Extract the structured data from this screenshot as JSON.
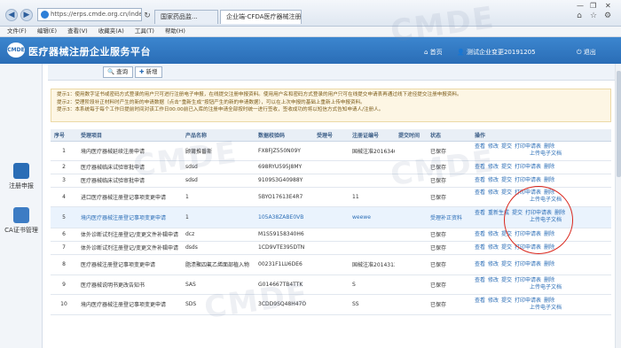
{
  "browser": {
    "address": "https://erps.cmde.org.cn/index/",
    "tabs": [
      "国家药品监...",
      "企业端-CFDA医疗器械注册..."
    ],
    "menus": [
      "文件(F)",
      "编辑(E)",
      "查看(V)",
      "收藏夹(A)",
      "工具(T)",
      "帮助(H)"
    ],
    "controls": {
      "min": "—",
      "max": "❐",
      "close": "✕"
    }
  },
  "header": {
    "logo_text": "CMDE",
    "title": "医疗器械注册企业服务平台",
    "home": "首页",
    "user": "测试企业变更20191205",
    "logout": "退出"
  },
  "sidebar": {
    "items": [
      {
        "label": "注册申报",
        "icon": "document-icon"
      },
      {
        "label": "CA证书管理",
        "icon": "ca-certificate-icon"
      }
    ]
  },
  "toolbar": {
    "query": "查询",
    "add": "新增"
  },
  "notice": [
    "提示1：使用数字证书或密码方式登录的用户只可进行注册电子申报，在线提交注册申报资料。使用用户名和密码方式登录的用户只可在线提交申请表再通过线下途径提交注册申报资料。",
    "提示2：受理阶段补正材料时产生的新的申请数据（点击“重新生成”按钮产生的新的申请数据），可以在上次申报的基础上重新上传申报资料。",
    "提示3：本系统每于每个工作日提前时间对该工作日00:00前已入库的注册申请全部按时统一进行签收，签收成功的将以短信方式告知申请人/注册人。"
  ],
  "table": {
    "headers": [
      "序号",
      "受理项目",
      "产品名称",
      "数据校验码",
      "受理号",
      "注册证编号",
      "提交时间",
      "状态",
      "操作"
    ],
    "rows": [
      {
        "no": "1",
        "item": "境内医疗器械延续注册申请",
        "product": "顾莆推番斯",
        "code": "FX8FJZ550N09Y",
        "accept": "",
        "cert": "国械注准2016340040",
        "time": "",
        "status": "已保存",
        "actions": [
          "查看",
          "修改",
          "提交",
          "打印申请表",
          "删除"
        ],
        "extra": "上传电子文档"
      },
      {
        "no": "2",
        "item": "医疗器械临床试验审批申请",
        "product": "sdsd",
        "code": "698RYU595J8MY",
        "accept": "",
        "cert": "",
        "time": "",
        "status": "已保存",
        "actions": [
          "查看",
          "修改",
          "提交",
          "打印申请表",
          "删除"
        ],
        "extra": ""
      },
      {
        "no": "3",
        "item": "医疗器械临床试验审批申请",
        "product": "sdsd",
        "code": "9109S3G40988Y",
        "accept": "",
        "cert": "",
        "time": "",
        "status": "已保存",
        "actions": [
          "查看",
          "修改",
          "提交",
          "打印申请表",
          "删除"
        ],
        "extra": ""
      },
      {
        "no": "4",
        "item": "进口医疗器械注册登记事项变更申请",
        "product": "1",
        "code": "5BYO17613E4R7",
        "accept": "",
        "cert": "11",
        "time": "",
        "status": "已保存",
        "actions": [
          "查看",
          "修改",
          "提交",
          "打印申请表",
          "删除"
        ],
        "extra": "上传电子文档"
      },
      {
        "no": "5",
        "item": "境内医疗器械注册登记事项变更申请",
        "product": "1",
        "code": "105A38ZABE0VB",
        "accept": "",
        "cert": "weewe",
        "time": "",
        "status": "受理补正资料",
        "actions": [
          "查看",
          "重新生成",
          "提交",
          "打印申请表",
          "删除"
        ],
        "extra": "上传电子文档",
        "highlight": true
      },
      {
        "no": "6",
        "item": "体外诊断试剂注册登记/变更文件补辑申请",
        "product": "dcz",
        "code": "M1S59158340H6",
        "accept": "",
        "cert": "",
        "time": "",
        "status": "已保存",
        "actions": [
          "查看",
          "修改",
          "提交",
          "打印申请表",
          "删除"
        ],
        "extra": ""
      },
      {
        "no": "7",
        "item": "体外诊断试剂注册登记/变更文件补辑申请",
        "product": "dsds",
        "code": "1CD9VTE395DTN",
        "accept": "",
        "cert": "",
        "time": "",
        "status": "已保存",
        "actions": [
          "查看",
          "修改",
          "提交",
          "打印申请表",
          "删除"
        ],
        "extra": ""
      },
      {
        "no": "8",
        "item": "医疗器械注册登记事项变更申请",
        "product": "脂渍聚四氟乙烯面部植入物",
        "code": "00231F1LU6DE6",
        "accept": "",
        "cert": "国械注准2014313861",
        "time": "",
        "status": "已保存",
        "actions": [
          "查看",
          "修改",
          "提交",
          "打印申请表",
          "删除"
        ],
        "extra": ""
      },
      {
        "no": "9",
        "item": "医疗器械说明书更改告知书",
        "product": "SAS",
        "code": "G014667TB4TTK",
        "accept": "",
        "cert": "S",
        "time": "",
        "status": "已保存",
        "actions": [
          "查看",
          "修改",
          "提交",
          "打印申请表",
          "删除"
        ],
        "extra": "上传电子文档"
      },
      {
        "no": "10",
        "item": "境内医疗器械注册登记事项变更申请",
        "product": "SDS",
        "code": "3CDD9SQ48H47O",
        "accept": "",
        "cert": "SS",
        "time": "",
        "status": "已保存",
        "actions": [
          "查看",
          "修改",
          "提交",
          "打印申请表",
          "删除"
        ],
        "extra": "上传电子文档"
      }
    ]
  },
  "watermark": "CMDE"
}
